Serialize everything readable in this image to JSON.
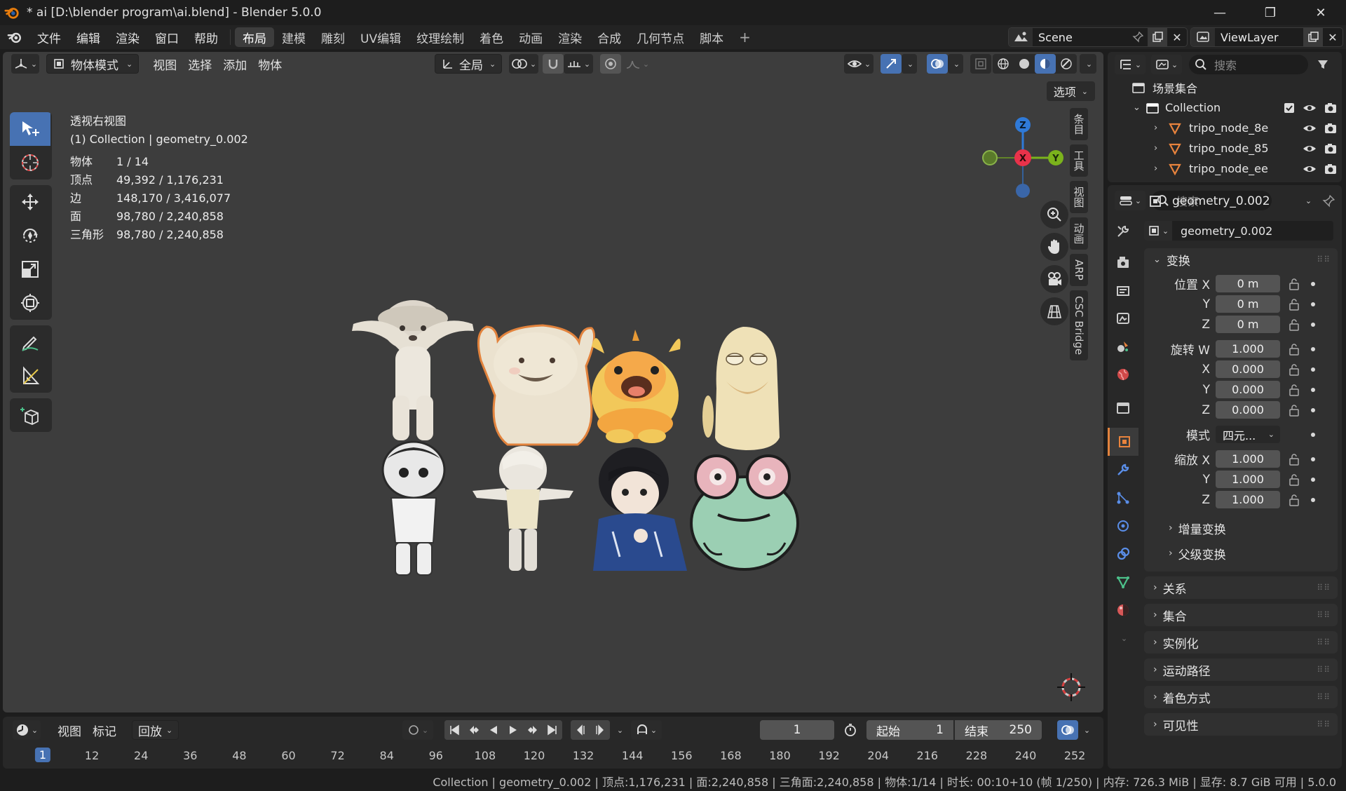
{
  "window": {
    "title": "* ai [D:\\blender program\\ai.blend] - Blender 5.0.0",
    "minimize_icon": "minimize-icon",
    "maximize_icon": "restore-icon",
    "close_icon": "close-icon"
  },
  "topbar": {
    "menus": [
      "文件",
      "编辑",
      "渲染",
      "窗口",
      "帮助"
    ],
    "workspaces": [
      "布局",
      "建模",
      "雕刻",
      "UV编辑",
      "纹理绘制",
      "着色",
      "动画",
      "渲染",
      "合成",
      "几何节点",
      "脚本"
    ],
    "active_workspace": "布局",
    "add_tab": "+",
    "scene": "Scene",
    "view_layer": "ViewLayer"
  },
  "viewport_header": {
    "mode": "物体模式",
    "menus": [
      "视图",
      "选择",
      "添加",
      "物体"
    ],
    "orientation": "全局",
    "options": "选项"
  },
  "viewport": {
    "view_name": "透视右视图",
    "collection_info": "(1) Collection | geometry_0.002",
    "stats": [
      {
        "label": "物体",
        "value": "1 / 14"
      },
      {
        "label": "顶点",
        "value": "49,392 / 1,176,231"
      },
      {
        "label": "边",
        "value": "148,170 / 3,416,077"
      },
      {
        "label": "面",
        "value": "98,780 / 2,240,858"
      },
      {
        "label": "三角形",
        "value": "98,780 / 2,240,858"
      }
    ],
    "side_tabs": [
      "条目",
      "工具",
      "视图",
      "动画",
      "ARP",
      "CSC Bridge"
    ],
    "gizmo": {
      "z": "Z",
      "x": "X",
      "y": "Y",
      "z_color": "#2f7ad8",
      "x_color": "#e8324a",
      "y_color": "#7bb31c"
    }
  },
  "outliner": {
    "search_placeholder": "搜索",
    "root": "场景集合",
    "collection": "Collection",
    "items": [
      "tripo_node_8e",
      "tripo_node_85",
      "tripo_node_ee"
    ]
  },
  "properties": {
    "search_placeholder": "搜索",
    "object_name": "geometry_0.002",
    "data_name": "geometry_0.002",
    "transform_title": "变换",
    "location": {
      "label_x": "位置 X",
      "x": "0 m",
      "y": "0 m",
      "z": "0 m"
    },
    "rotation": {
      "label_w": "旋转 W",
      "w": "1.000",
      "x": "0.000",
      "y": "0.000",
      "z": "0.000"
    },
    "mode": {
      "label": "模式",
      "value": "四元..."
    },
    "scale": {
      "label_x": "缩放 X",
      "x": "1.000",
      "y": "1.000",
      "z": "1.000"
    },
    "axis_y": "Y",
    "axis_z": "Z",
    "axis_x": "X",
    "delta_transform": "增量变换",
    "parent_transform": "父级变换",
    "panels": [
      "关系",
      "集合",
      "实例化",
      "运动路径",
      "着色方式",
      "可见性"
    ]
  },
  "timeline": {
    "menus": [
      "视图",
      "标记"
    ],
    "playback": "回放",
    "current_frame": "1",
    "start_label": "起始",
    "start": "1",
    "end_label": "结束",
    "end": "250",
    "ticks": [
      "1",
      "12",
      "24",
      "36",
      "48",
      "60",
      "72",
      "84",
      "96",
      "108",
      "120",
      "132",
      "144",
      "156",
      "168",
      "180",
      "192",
      "204",
      "216",
      "228",
      "240",
      "252"
    ]
  },
  "statusbar": {
    "text": "Collection | geometry_0.002 | 顶点:1,176,231 | 面:2,240,858 | 三角面:2,240,858 | 物体:1/14 | 时长: 00:10+10 (帧 1/250) | 内存: 726.3 MiB | 显存: 8.7 GiB 可用 | 5.0.0"
  },
  "colors": {
    "accent": "#4772b3",
    "selection": "#e2833d",
    "viewport_bg": "#3d3d3d"
  }
}
